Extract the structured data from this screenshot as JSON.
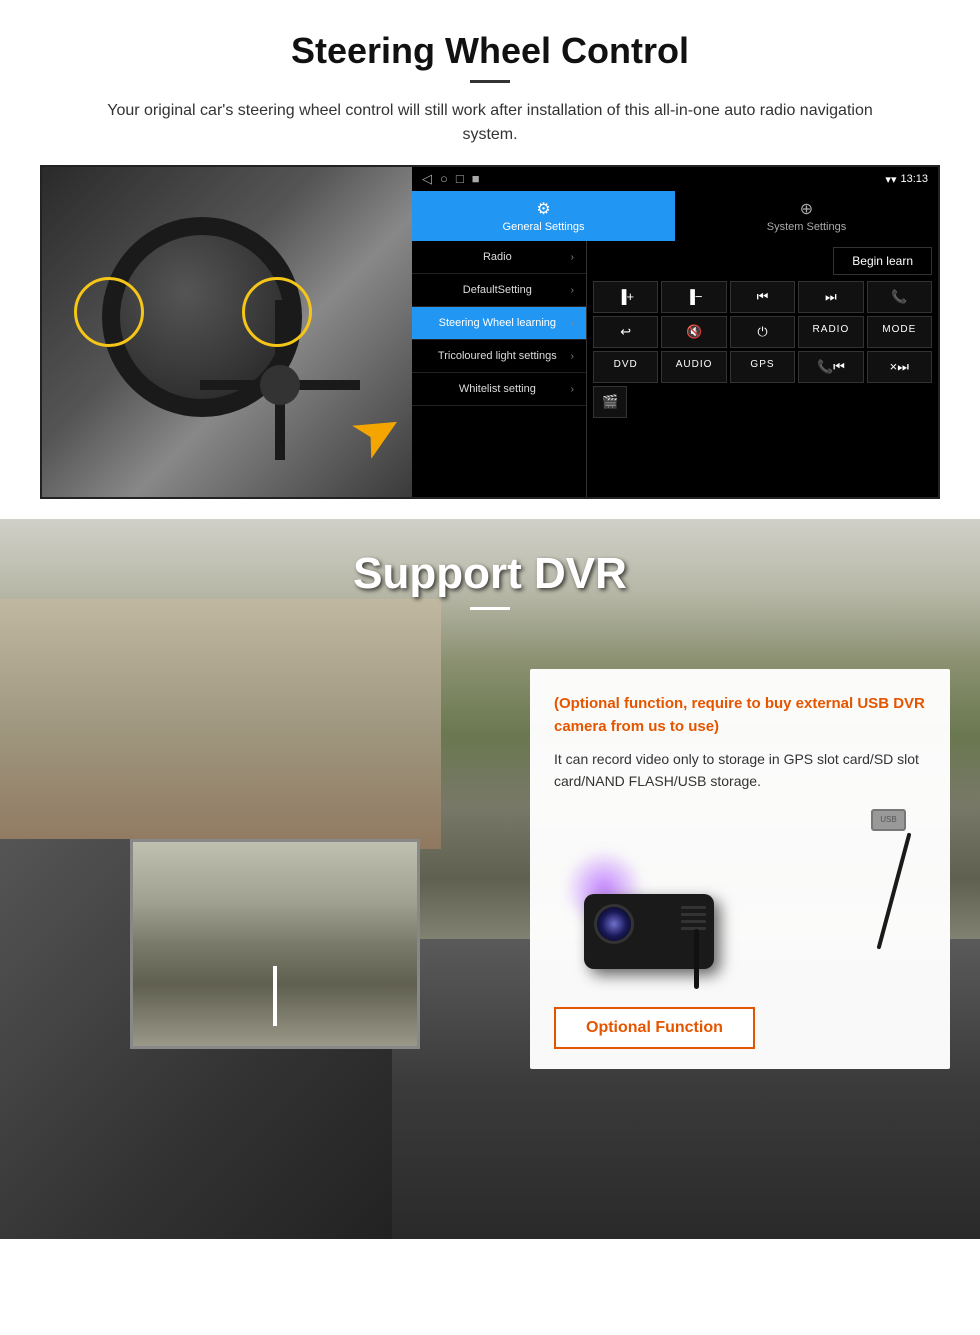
{
  "section1": {
    "title": "Steering Wheel Control",
    "subtitle": "Your original car's steering wheel control will still work after installation of this all-in-one auto radio navigation system.",
    "android": {
      "statusbar": {
        "icons": [
          "◁",
          "○",
          "□",
          "■"
        ],
        "time": "13:13",
        "signal_icons": "▼"
      },
      "tabs": [
        {
          "label": "General Settings",
          "active": true
        },
        {
          "label": "System Settings",
          "active": false
        }
      ],
      "menu_items": [
        {
          "label": "Radio",
          "active": false
        },
        {
          "label": "DefaultSetting",
          "active": false
        },
        {
          "label": "Steering Wheel learning",
          "active": true
        },
        {
          "label": "Tricoloured light settings",
          "active": false
        },
        {
          "label": "Whitelist setting",
          "active": false
        }
      ],
      "begin_learn": "Begin learn",
      "control_buttons_row1": [
        "▐+",
        "▐−",
        "⏮",
        "⏭",
        "📞"
      ],
      "control_buttons_row2": [
        "↩",
        "🔇×",
        "⏻",
        "RADIO",
        "MODE"
      ],
      "control_buttons_row3": [
        "DVD",
        "AUDIO",
        "GPS",
        "📞⏮",
        "×⏭"
      ],
      "control_buttons_row4": [
        "🎬"
      ]
    }
  },
  "section2": {
    "title": "Support DVR",
    "optional_text": "(Optional function, require to buy external USB DVR camera from us to use)",
    "desc_text": "It can record video only to storage in GPS slot card/SD slot card/NAND FLASH/USB storage.",
    "optional_function_btn": "Optional Function"
  }
}
